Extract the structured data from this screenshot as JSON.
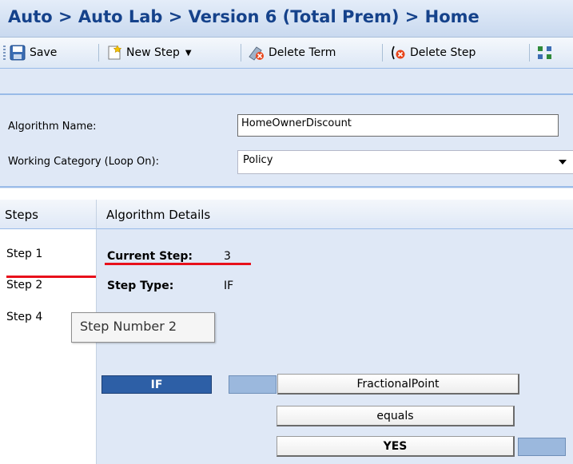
{
  "title": "Auto > Auto Lab > Version 6 (Total Prem) > Home",
  "toolbar": {
    "save": "Save",
    "new_step": "New Step",
    "delete_term": "Delete Term",
    "delete_step": "Delete Step"
  },
  "form": {
    "algorithm_name_label": "Algorithm Name:",
    "algorithm_name_value": "HomeOwnerDiscount",
    "working_category_label": "Working Category (Loop On):",
    "working_category_value": "Policy"
  },
  "grid": {
    "steps_header": "Steps",
    "details_header": "Algorithm Details"
  },
  "steps": [
    "Step 1",
    "Step 2",
    "Step 4"
  ],
  "details": {
    "current_step_label": "Current Step:",
    "current_step_value": "3",
    "step_type_label": "Step Type:",
    "step_type_value": "IF"
  },
  "tooltip": "Step Number 2",
  "logic": {
    "if_label": "IF",
    "term1": "FractionalPoint",
    "operator": "equals",
    "term2": "YES"
  },
  "colors": {
    "title_text": "#15428b",
    "panel_bg": "#dfe8f6",
    "highlight_red": "#e8101b",
    "if_block": "#2d5fa6",
    "placeholder_block": "#9bb8dd"
  }
}
